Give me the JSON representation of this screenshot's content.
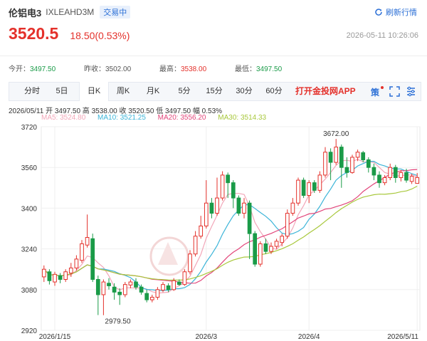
{
  "header": {
    "name": "伦铝电3",
    "code": "IXLEAHD3M",
    "status_badge": "交易中",
    "refresh_label": "刷新行情",
    "price": "3520.5",
    "change": "18.50(0.53%)",
    "timestamp": "2026-05-11 10:26:06"
  },
  "stats": [
    {
      "label": "今开：",
      "value": "3497.50",
      "color": "green"
    },
    {
      "label": "昨收：",
      "value": "3502.00",
      "color": "plain"
    },
    {
      "label": "最高：",
      "value": "3538.00",
      "color": "red"
    },
    {
      "label": "最低：",
      "value": "3497.50",
      "color": "green"
    }
  ],
  "tabs": [
    "分时",
    "5日",
    "日K",
    "周K",
    "月K",
    "5分",
    "15分",
    "30分",
    "60分"
  ],
  "active_tab": "日K",
  "app_link": "打开金投网APP",
  "tools": [
    "strategy-icon",
    "fullscreen-icon",
    "settings-icon"
  ],
  "tool_strategy_label": "策",
  "info_line": "2026/05/11  开 3497.50  高 3538.00  收 3520.50  低 3497.50  幅 0.53%",
  "ma": [
    {
      "label": "MA5: 3524.80",
      "color": "#f2a7b9"
    },
    {
      "label": "MA10: 3521.25",
      "color": "#3bb4d8"
    },
    {
      "label": "MA20: 3556.20",
      "color": "#e2457a"
    },
    {
      "label": "MA30: 3514.33",
      "color": "#a8c83c"
    }
  ],
  "colors": {
    "up": "#e4312b",
    "down": "#1a9b48",
    "accent": "#2b6fd6"
  },
  "chart_data": {
    "type": "candlestick",
    "ylim": [
      2920,
      3720
    ],
    "yticks": [
      "3720",
      "3560",
      "3400",
      "3240",
      "3080",
      "2920"
    ],
    "xticks": [
      {
        "label": "2026/1/15",
        "index": 2
      },
      {
        "label": "2026/3",
        "index": 30
      },
      {
        "label": "2026/4",
        "index": 49
      },
      {
        "label": "2026/5/11",
        "index": 69
      }
    ],
    "high_label": {
      "text": "3672.00",
      "index": 54,
      "value": 3672
    },
    "low_label": {
      "text": "2979.50",
      "index": 11,
      "value": 2979.5
    },
    "candles": [
      {
        "o": 3130,
        "c": 3160,
        "h": 3175,
        "l": 3110
      },
      {
        "o": 3150,
        "c": 3115,
        "h": 3160,
        "l": 3100
      },
      {
        "o": 3110,
        "c": 3140,
        "h": 3150,
        "l": 3095
      },
      {
        "o": 3135,
        "c": 3120,
        "h": 3145,
        "l": 3105
      },
      {
        "o": 3120,
        "c": 3150,
        "h": 3160,
        "l": 3110
      },
      {
        "o": 3145,
        "c": 3165,
        "h": 3185,
        "l": 3130
      },
      {
        "o": 3165,
        "c": 3200,
        "h": 3215,
        "l": 3155
      },
      {
        "o": 3195,
        "c": 3260,
        "h": 3275,
        "l": 3185
      },
      {
        "o": 3255,
        "c": 3285,
        "h": 3375,
        "l": 3245
      },
      {
        "o": 3280,
        "c": 3120,
        "h": 3300,
        "l": 3110
      },
      {
        "o": 3120,
        "c": 3060,
        "h": 3135,
        "l": 2980
      },
      {
        "o": 3060,
        "c": 3110,
        "h": 3120,
        "l": 2979.5
      },
      {
        "o": 3105,
        "c": 3095,
        "h": 3125,
        "l": 3080
      },
      {
        "o": 3090,
        "c": 3070,
        "h": 3105,
        "l": 3040
      },
      {
        "o": 3070,
        "c": 3060,
        "h": 3085,
        "l": 3020
      },
      {
        "o": 3060,
        "c": 3100,
        "h": 3110,
        "l": 3050
      },
      {
        "o": 3098,
        "c": 3110,
        "h": 3120,
        "l": 3085
      },
      {
        "o": 3110,
        "c": 3090,
        "h": 3125,
        "l": 3080
      },
      {
        "o": 3090,
        "c": 3070,
        "h": 3100,
        "l": 3060
      },
      {
        "o": 3065,
        "c": 3040,
        "h": 3080,
        "l": 3030
      },
      {
        "o": 3040,
        "c": 3050,
        "h": 3060,
        "l": 3030
      },
      {
        "o": 3050,
        "c": 3080,
        "h": 3090,
        "l": 3040
      },
      {
        "o": 3078,
        "c": 3100,
        "h": 3110,
        "l": 3070
      },
      {
        "o": 3095,
        "c": 3080,
        "h": 3105,
        "l": 3070
      },
      {
        "o": 3080,
        "c": 3115,
        "h": 3125,
        "l": 3075
      },
      {
        "o": 3110,
        "c": 3100,
        "h": 3120,
        "l": 3095
      },
      {
        "o": 3100,
        "c": 3150,
        "h": 3160,
        "l": 3095
      },
      {
        "o": 3150,
        "c": 3220,
        "h": 3235,
        "l": 3140
      },
      {
        "o": 3220,
        "c": 3290,
        "h": 3310,
        "l": 3210
      },
      {
        "o": 3290,
        "c": 3330,
        "h": 3370,
        "l": 3280
      },
      {
        "o": 3330,
        "c": 3420,
        "h": 3510,
        "l": 3320
      },
      {
        "o": 3420,
        "c": 3380,
        "h": 3440,
        "l": 3360
      },
      {
        "o": 3380,
        "c": 3440,
        "h": 3520,
        "l": 3370
      },
      {
        "o": 3440,
        "c": 3530,
        "h": 3545,
        "l": 3430
      },
      {
        "o": 3530,
        "c": 3500,
        "h": 3540,
        "l": 3440
      },
      {
        "o": 3500,
        "c": 3440,
        "h": 3510,
        "l": 3400
      },
      {
        "o": 3440,
        "c": 3380,
        "h": 3450,
        "l": 3370
      },
      {
        "o": 3380,
        "c": 3420,
        "h": 3440,
        "l": 3360
      },
      {
        "o": 3420,
        "c": 3300,
        "h": 3430,
        "l": 3200
      },
      {
        "o": 3300,
        "c": 3180,
        "h": 3310,
        "l": 3170
      },
      {
        "o": 3180,
        "c": 3260,
        "h": 3270,
        "l": 3170
      },
      {
        "o": 3260,
        "c": 3230,
        "h": 3280,
        "l": 3220
      },
      {
        "o": 3230,
        "c": 3250,
        "h": 3265,
        "l": 3220
      },
      {
        "o": 3250,
        "c": 3270,
        "h": 3280,
        "l": 3240
      },
      {
        "o": 3265,
        "c": 3290,
        "h": 3300,
        "l": 3250
      },
      {
        "o": 3290,
        "c": 3380,
        "h": 3395,
        "l": 3280
      },
      {
        "o": 3380,
        "c": 3420,
        "h": 3440,
        "l": 3370
      },
      {
        "o": 3420,
        "c": 3510,
        "h": 3520,
        "l": 3410
      },
      {
        "o": 3510,
        "c": 3450,
        "h": 3520,
        "l": 3440
      },
      {
        "o": 3450,
        "c": 3500,
        "h": 3510,
        "l": 3420
      },
      {
        "o": 3500,
        "c": 3470,
        "h": 3510,
        "l": 3460
      },
      {
        "o": 3470,
        "c": 3530,
        "h": 3545,
        "l": 3460
      },
      {
        "o": 3530,
        "c": 3620,
        "h": 3640,
        "l": 3520
      },
      {
        "o": 3620,
        "c": 3580,
        "h": 3635,
        "l": 3510
      },
      {
        "o": 3580,
        "c": 3640,
        "h": 3672,
        "l": 3570
      },
      {
        "o": 3640,
        "c": 3560,
        "h": 3650,
        "l": 3480
      },
      {
        "o": 3560,
        "c": 3540,
        "h": 3600,
        "l": 3520
      },
      {
        "o": 3540,
        "c": 3600,
        "h": 3610,
        "l": 3535
      },
      {
        "o": 3600,
        "c": 3620,
        "h": 3630,
        "l": 3585
      },
      {
        "o": 3618,
        "c": 3590,
        "h": 3625,
        "l": 3580
      },
      {
        "o": 3590,
        "c": 3560,
        "h": 3600,
        "l": 3540
      },
      {
        "o": 3560,
        "c": 3530,
        "h": 3575,
        "l": 3510
      },
      {
        "o": 3530,
        "c": 3500,
        "h": 3545,
        "l": 3480
      },
      {
        "o": 3500,
        "c": 3520,
        "h": 3530,
        "l": 3490
      },
      {
        "o": 3520,
        "c": 3560,
        "h": 3575,
        "l": 3510
      },
      {
        "o": 3560,
        "c": 3520,
        "h": 3570,
        "l": 3500
      },
      {
        "o": 3520,
        "c": 3540,
        "h": 3550,
        "l": 3505
      },
      {
        "o": 3540,
        "c": 3510,
        "h": 3555,
        "l": 3500
      },
      {
        "o": 3505,
        "c": 3525,
        "h": 3535,
        "l": 3495
      },
      {
        "o": 3497.5,
        "c": 3520.5,
        "h": 3538,
        "l": 3497.5
      }
    ]
  }
}
